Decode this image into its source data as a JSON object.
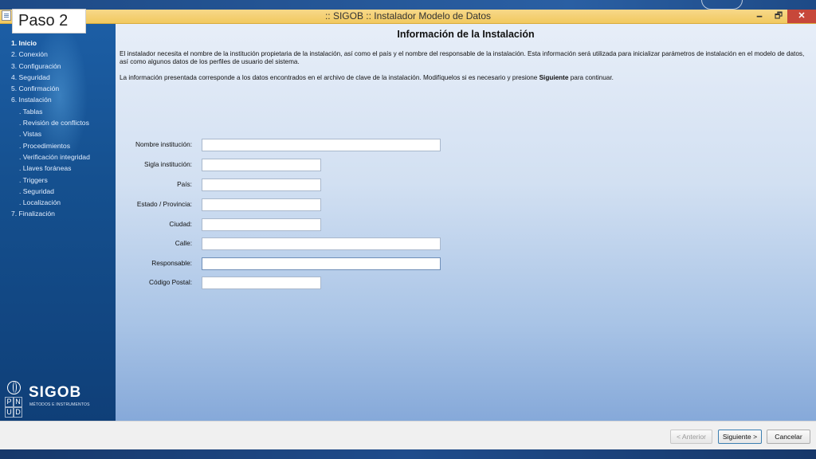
{
  "window": {
    "title": ":: SIGOB :: Instalador Modelo de Datos",
    "minimize": "🗕",
    "maximize": "🗗",
    "close": "✕"
  },
  "overlay_label": "Paso 2",
  "sidebar": {
    "steps": [
      {
        "label": "1. Inicio",
        "active": true,
        "sub": false
      },
      {
        "label": "2. Conexión",
        "sub": false
      },
      {
        "label": "3. Configuración",
        "sub": false
      },
      {
        "label": "4. Seguridad",
        "sub": false
      },
      {
        "label": "5. Confirmación",
        "sub": false
      },
      {
        "label": "6. Instalación",
        "sub": false
      },
      {
        "label": ". Tablas",
        "sub": true
      },
      {
        "label": ". Revisión de conflictos",
        "sub": true
      },
      {
        "label": ". Vistas",
        "sub": true
      },
      {
        "label": ". Procedimientos",
        "sub": true
      },
      {
        "label": ". Verificación integridad",
        "sub": true
      },
      {
        "label": ". Llaves foráneas",
        "sub": true
      },
      {
        "label": ". Triggers",
        "sub": true
      },
      {
        "label": ". Seguridad",
        "sub": true
      },
      {
        "label": ". Localización",
        "sub": true
      },
      {
        "label": "7. Finalización",
        "sub": false
      }
    ],
    "logo": {
      "name": "SIGOB",
      "subtitle": "MÉTODOS E INSTRUMENTOS",
      "letters": [
        "P",
        "N",
        "U",
        "D"
      ]
    }
  },
  "main": {
    "heading": "Información de la Instalación",
    "description": "El instalador necesita el nombre de la institución propietaria de la instalación, así como el país y el nombre del responsable de la instalación. Esta información será utilizada para inicializar parámetros de instalación en el modelo de datos, así como algunos datos de los perfiles de usuario del sistema.",
    "note_prefix": "La información presentada corresponde a los datos encontrados en el archivo de clave de la instalación. Modifíquelos si es necesario y presione ",
    "note_bold": "Siguiente",
    "note_suffix": " para continuar.",
    "fields": {
      "nombre": {
        "label": "Nombre institución:",
        "value": ""
      },
      "sigla": {
        "label": "Sigla institución:",
        "value": ""
      },
      "pais": {
        "label": "País:",
        "value": ""
      },
      "estado": {
        "label": "Estado / Provincia:",
        "value": ""
      },
      "ciudad": {
        "label": "Ciudad:",
        "value": ""
      },
      "calle": {
        "label": "Calle:",
        "value": ""
      },
      "responsable": {
        "label": "Responsable:",
        "value": ""
      },
      "postal": {
        "label": "Código Postal:",
        "value": ""
      }
    }
  },
  "footer": {
    "back": "< Anterior",
    "next": "Siguiente >",
    "cancel": "Cancelar"
  }
}
